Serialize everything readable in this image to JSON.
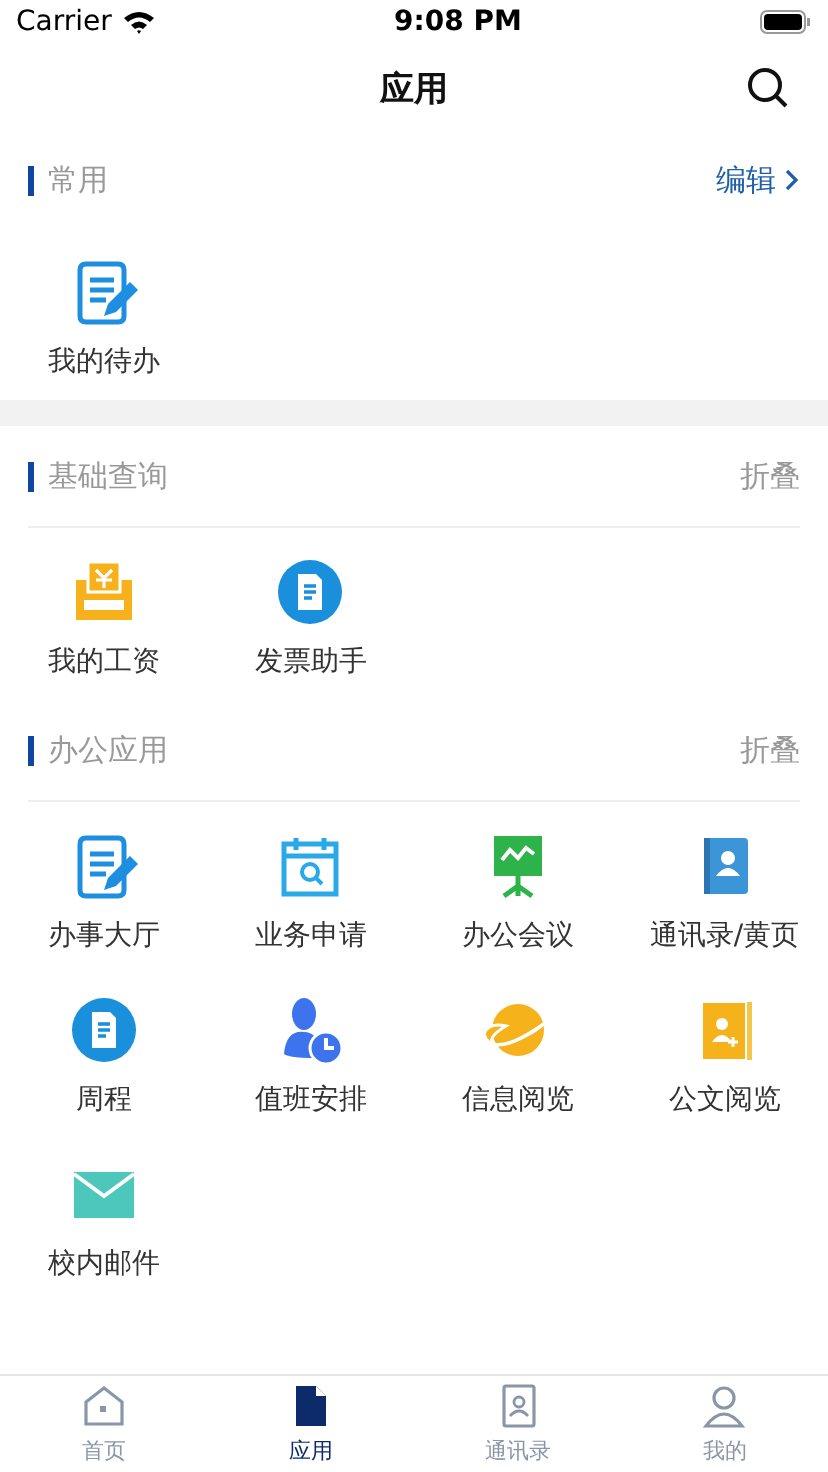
{
  "status_bar": {
    "carrier": "Carrier",
    "time": "9:08 PM"
  },
  "nav": {
    "title": "应用"
  },
  "sections": [
    {
      "title": "常用",
      "action": {
        "kind": "edit",
        "label": "编辑"
      },
      "items": [
        {
          "kind": "edit",
          "label": "我的待办"
        }
      ]
    },
    {
      "title": "基础查询",
      "action": {
        "kind": "collapse",
        "label": "折叠"
      },
      "items": [
        {
          "kind": "salary",
          "label": "我的工资"
        },
        {
          "kind": "invoice",
          "label": "发票助手"
        }
      ]
    },
    {
      "title": "办公应用",
      "action": {
        "kind": "collapse",
        "label": "折叠"
      },
      "items": [
        {
          "kind": "edit",
          "label": "办事大厅"
        },
        {
          "kind": "calendar",
          "label": "业务申请"
        },
        {
          "kind": "meeting",
          "label": "办公会议"
        },
        {
          "kind": "contacts",
          "label": "通讯录/黄页"
        },
        {
          "kind": "invoice",
          "label": "周程"
        },
        {
          "kind": "duty",
          "label": "值班安排"
        },
        {
          "kind": "globe",
          "label": "信息阅览"
        },
        {
          "kind": "folder",
          "label": "公文阅览"
        },
        {
          "kind": "mail",
          "label": "校内邮件"
        }
      ]
    }
  ],
  "tab_bar": [
    {
      "kind": "home",
      "label": "首页",
      "selected": false
    },
    {
      "kind": "apps",
      "label": "应用",
      "selected": true
    },
    {
      "kind": "contacts",
      "label": "通讯录",
      "selected": false
    },
    {
      "kind": "me",
      "label": "我的",
      "selected": false
    }
  ]
}
